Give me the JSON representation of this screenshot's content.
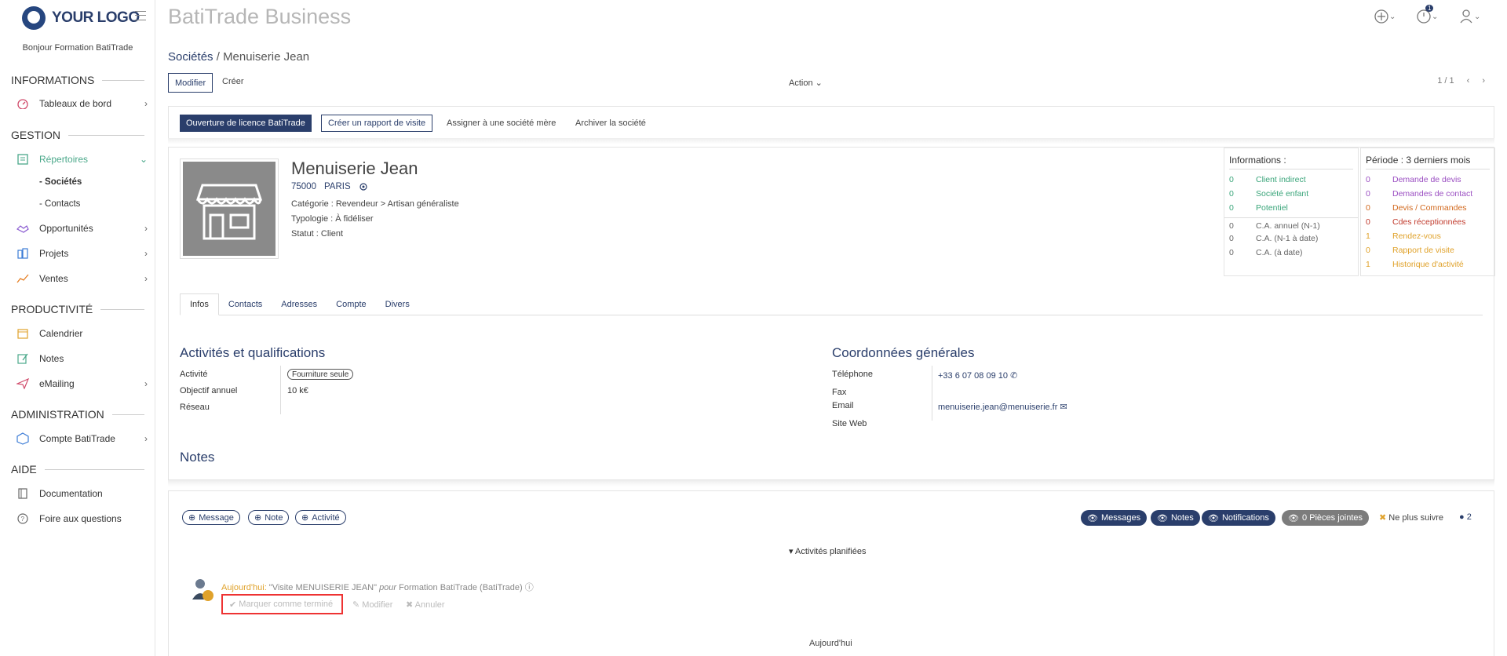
{
  "sidebar": {
    "logo_text": "YOUR LOGO",
    "greeting": "Bonjour Formation BatiTrade",
    "sections": {
      "informations": "INFORMATIONS",
      "gestion": "GESTION",
      "productivite": "PRODUCTIVITÉ",
      "administration": "ADMINISTRATION",
      "aide": "AIDE"
    },
    "items": {
      "tableaux": "Tableaux de bord",
      "repertoires": "Répertoires",
      "societes": "- Sociétés",
      "contacts": "- Contacts",
      "opportunites": "Opportunités",
      "projets": "Projets",
      "ventes": "Ventes",
      "calendrier": "Calendrier",
      "notes": "Notes",
      "emailing": "eMailing",
      "compte": "Compte BatiTrade",
      "documentation": "Documentation",
      "faq": "Foire aux questions"
    }
  },
  "header": {
    "title": "BatiTrade Business",
    "notif_count": "1"
  },
  "breadcrumb": {
    "parent": "Sociétés",
    "separator": " / ",
    "current": "Menuiserie Jean"
  },
  "toolbar": {
    "modifier": "Modifier",
    "creer": "Créer",
    "action": "Action ⌄",
    "pager": "1 / 1"
  },
  "actions": {
    "licence": "Ouverture de licence BatiTrade",
    "rapport": "Créer un rapport de visite",
    "assigner": "Assigner à une société mère",
    "archiver": "Archiver la société"
  },
  "company": {
    "name": "Menuiserie Jean",
    "zip": "75000",
    "city": "PARIS",
    "categorie": "Catégorie : Revendeur > Artisan généraliste",
    "typologie": "Typologie : À fidéliser",
    "statut": "Statut : Client"
  },
  "info_box": {
    "title": "Informations :",
    "rows": [
      {
        "n": "0",
        "label": "Client indirect",
        "color": "#3aa57a"
      },
      {
        "n": "0",
        "label": "Société enfant",
        "color": "#3aa57a"
      },
      {
        "n": "0",
        "label": "Potentiel",
        "color": "#3aa57a"
      },
      {
        "n": "0",
        "label": "C.A. annuel (N-1)",
        "color": "#666666"
      },
      {
        "n": "0",
        "label": "C.A. (N-1 à date)",
        "color": "#666666"
      },
      {
        "n": "0",
        "label": "C.A. (à date)",
        "color": "#666666"
      }
    ]
  },
  "period_box": {
    "title": "Période : 3 derniers mois",
    "rows": [
      {
        "n": "0",
        "label": "Demande de devis",
        "color": "#9b4fc2"
      },
      {
        "n": "0",
        "label": "Demandes de contact",
        "color": "#9b4fc2"
      },
      {
        "n": "0",
        "label": "Devis / Commandes",
        "color": "#d2691e"
      },
      {
        "n": "0",
        "label": "Cdes réceptionnées",
        "color": "#c0392b"
      },
      {
        "n": "1",
        "label": "Rendez-vous",
        "color": "#e0a22b"
      },
      {
        "n": "0",
        "label": "Rapport de visite",
        "color": "#e0a22b"
      },
      {
        "n": "1",
        "label": "Historique d'activité",
        "color": "#e0a22b"
      }
    ]
  },
  "tabs": [
    "Infos",
    "Contacts",
    "Adresses",
    "Compte",
    "Divers"
  ],
  "activites": {
    "title": "Activités et qualifications",
    "activite_label": "Activité",
    "activite_value": "Fourniture seule",
    "objectif_label": "Objectif annuel",
    "objectif_value": "10 k€",
    "reseau_label": "Réseau"
  },
  "coordonnees": {
    "title": "Coordonnées générales",
    "tel_label": "Téléphone",
    "tel_value": "+33 6 07 08 09 10",
    "fax_label": "Fax",
    "email_label": "Email",
    "email_value": "menuiserie.jean@menuiserie.fr",
    "web_label": "Site Web"
  },
  "notes_title": "Notes",
  "chatter": {
    "message": "Message",
    "note": "Note",
    "activite": "Activité",
    "messages_filter": "Messages",
    "notes_filter": "Notes",
    "notifications_filter": "Notifications",
    "pieces": "0 Pièces jointes",
    "unfollow": "Ne plus suivre",
    "followers": "2",
    "planned": "Activités planifiées",
    "today": "Aujourd'hui:",
    "activity_text": " \"Visite MENUISERIE JEAN\" ",
    "pour": "pour",
    "user": " Formation BatiTrade (BatiTrade)",
    "mark_done": "Marquer comme terminé",
    "edit": "Modifier",
    "cancel": "Annuler",
    "today_sep": "Aujourd'hui"
  }
}
